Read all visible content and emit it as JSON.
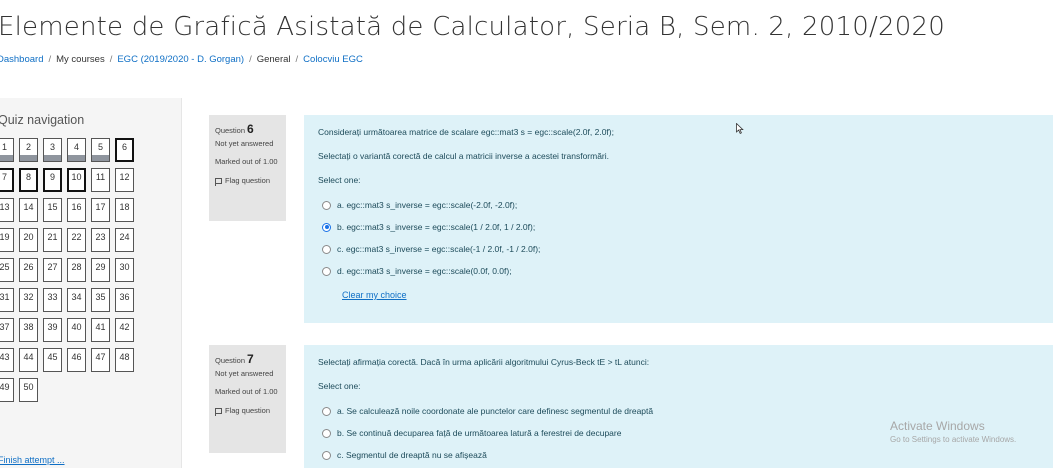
{
  "page": {
    "title": "Elemente de Grafică Asistată de Calculator, Seria B, Sem. 2, 2010/2020"
  },
  "breadcrumb": {
    "dashboard": "Dashboard",
    "my_courses": "My courses",
    "course": "EGC (2019/2020 - D. Gorgan)",
    "general": "General",
    "quiz": "Colocviu EGC",
    "separator": "/"
  },
  "quiz_nav": {
    "title": "Quiz navigation",
    "questions": [
      "1",
      "2",
      "3",
      "4",
      "5",
      "6",
      "7",
      "8",
      "9",
      "10",
      "11",
      "12",
      "13",
      "14",
      "15",
      "16",
      "17",
      "18",
      "19",
      "20",
      "21",
      "22",
      "23",
      "24",
      "25",
      "26",
      "27",
      "28",
      "29",
      "30",
      "31",
      "32",
      "33",
      "34",
      "35",
      "36",
      "37",
      "38",
      "39",
      "40",
      "41",
      "42",
      "43",
      "44",
      "45",
      "46",
      "47",
      "48",
      "49",
      "50"
    ],
    "answered": [
      "1",
      "2",
      "3",
      "4",
      "5"
    ],
    "current": [
      "6",
      "7",
      "8",
      "9",
      "10"
    ],
    "finish_label": "Finish attempt ..."
  },
  "question6": {
    "label": "Question",
    "number": "6",
    "state": "Not yet answered",
    "marked": "Marked out of 1.00",
    "flag": "Flag question",
    "text1": "Considerați următoarea matrice de scalare egc::mat3 s = egc::scale(2.0f, 2.0f);",
    "text2": "Selectați o variantă corectă de calcul a matricii inverse a acestei transformări.",
    "select_one": "Select one:",
    "options": [
      "a. egc::mat3 s_inverse = egc::scale(-2.0f, -2.0f);",
      "b. egc::mat3 s_inverse = egc::scale(1 / 2.0f, 1 / 2.0f);",
      "c. egc::mat3 s_inverse = egc::scale(-1 / 2.0f, -1 / 2.0f);",
      "d. egc::mat3 s_inverse = egc::scale(0.0f, 0.0f);"
    ],
    "selected_index": 1,
    "clear": "Clear my choice"
  },
  "question7": {
    "label": "Question",
    "number": "7",
    "state": "Not yet answered",
    "marked": "Marked out of 1.00",
    "flag": "Flag question",
    "text1": "Selectați afirmația corectă. Dacă în urma aplicării algoritmului Cyrus-Beck tE > tL atunci:",
    "select_one": "Select one:",
    "options": [
      "a. Se calculează noile coordonate ale punctelor care definesc segmentul de dreaptă",
      "b. Se continuă decuparea față de următoarea latură a ferestrei de decupare",
      "c. Segmentul de dreaptă nu se afișează"
    ]
  },
  "watermark": {
    "line1": "Activate Windows",
    "line2": "Go to Settings to activate Windows."
  },
  "colors": {
    "accent": "#0f6fc5",
    "question_bg": "#def2f8",
    "info_bg": "#e5e5e5",
    "radio_checked": "#1a73e8"
  }
}
